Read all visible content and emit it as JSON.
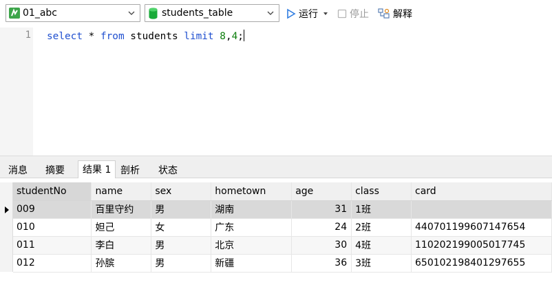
{
  "toolbar": {
    "connection": "01_abc",
    "table": "students_table",
    "run_label": "运行",
    "stop_label": "停止",
    "explain_label": "解释",
    "icons": {
      "connection": "connection-icon",
      "table": "database-icon",
      "run": "play-icon",
      "stop": "stop-icon",
      "explain": "explain-icon"
    },
    "colors": {
      "connection": "#3da54a",
      "database": "#1aab3a",
      "run": "#2f7de1"
    }
  },
  "editor": {
    "line_number": "1",
    "tokens": {
      "select": "select",
      "star": " * ",
      "from": "from",
      "table": " students ",
      "limit": "limit",
      "space": " ",
      "n1": "8",
      "comma": ",",
      "n2": "4",
      "semi": ";"
    }
  },
  "tabs": [
    {
      "label": "消息"
    },
    {
      "label": "摘要"
    },
    {
      "label": "结果 1"
    },
    {
      "label": "剖析"
    },
    {
      "label": "状态"
    }
  ],
  "active_tab": "结果 1",
  "grid": {
    "columns": [
      "studentNo",
      "name",
      "sex",
      "hometown",
      "age",
      "class",
      "card"
    ],
    "rows": [
      [
        "009",
        "百里守约",
        "男",
        "湖南",
        "31",
        "1班",
        ""
      ],
      [
        "010",
        "妲己",
        "女",
        "广东",
        "24",
        "2班",
        "440701199607147654"
      ],
      [
        "011",
        "李白",
        "男",
        "北京",
        "30",
        "4班",
        "110202199005017745"
      ],
      [
        "012",
        "孙膑",
        "男",
        "新疆",
        "36",
        "3班",
        "650102198401297655"
      ]
    ]
  }
}
